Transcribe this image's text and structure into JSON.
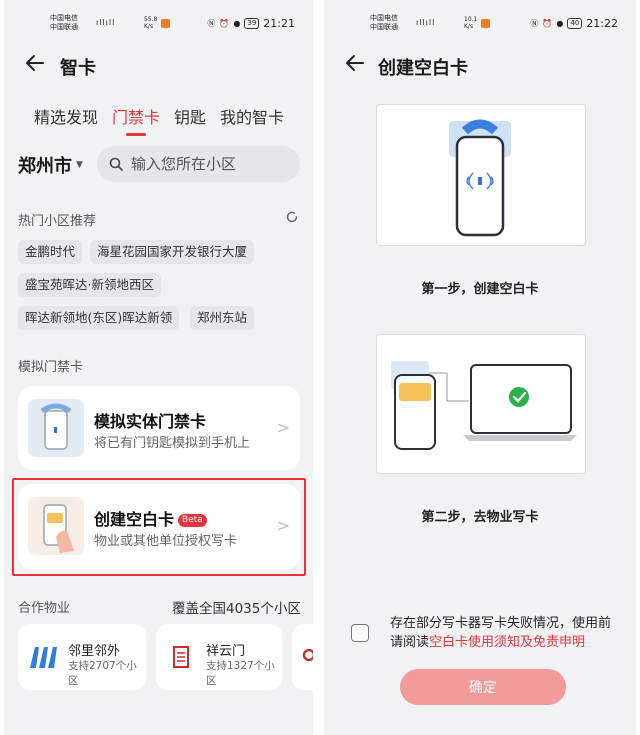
{
  "left_screen": {
    "status_bar": {
      "carrier_1": "中国电信",
      "carrier_2": "中国联通",
      "speed_value": "55.8",
      "speed_unit": "K/s",
      "battery": "39",
      "time": "21:21"
    },
    "header": {
      "title": "智卡"
    },
    "tabs": [
      "精选发现",
      "门禁卡",
      "钥匙",
      "我的智卡"
    ],
    "active_tab_index": 1,
    "city": "郑州市",
    "search": {
      "placeholder": "输入您所在小区"
    },
    "hot_section": {
      "title": "热门小区推荐",
      "chips": [
        "金鹏时代",
        "海星花园国家开发银行大厦",
        "盛宝苑晖达·新领地西区",
        "晖达新领地(东区)晖达新领",
        "郑州东站"
      ]
    },
    "sim_section": {
      "title": "模拟门禁卡",
      "cards": [
        {
          "title": "模拟实体门禁卡",
          "subtitle": "将已有门钥匙模拟到手机上"
        },
        {
          "title": "创建空白卡",
          "badge": "Beta",
          "subtitle": "物业或其他单位授权写卡"
        }
      ]
    },
    "partner_section": {
      "title": "合作物业",
      "coverage": "覆盖全国4035个小区",
      "partners": [
        {
          "name": "邻里邻外",
          "subtitle": "支持2707个小区"
        },
        {
          "name": "祥云门",
          "subtitle": "支持1327个小区"
        }
      ]
    }
  },
  "right_screen": {
    "status_bar": {
      "carrier_1": "中国电信",
      "carrier_2": "中国联通",
      "speed_value": "10.1",
      "speed_unit": "K/s",
      "battery": "40",
      "time": "21:22"
    },
    "header": {
      "title": "创建空白卡"
    },
    "steps": [
      "第一步，创建空白卡",
      "第二步，去物业写卡"
    ],
    "notice_text": "存在部分写卡器写卡失败情况，使用前请阅读",
    "notice_link": "空白卡使用须知及免责申明",
    "confirm_label": "确定"
  },
  "colors": {
    "accent": "#e8333a",
    "confirm_disabled": "#f39a9a",
    "page_bg": "#f2f2f5",
    "card_bg": "#ffffff",
    "logo_blue": "#2f7fd8",
    "check_green": "#2bb14a",
    "card_yellow": "#f7c25a"
  },
  "icons": [
    "back-arrow-icon",
    "search-icon",
    "refresh-icon",
    "chevron-right-icon",
    "nfc-icon",
    "check-icon"
  ]
}
